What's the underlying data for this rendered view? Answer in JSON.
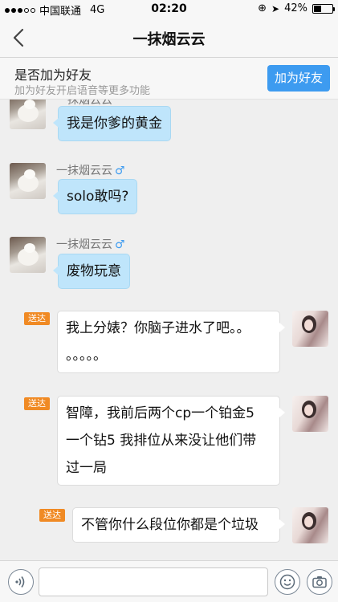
{
  "status_bar": {
    "carrier": "中国联通",
    "network": "4G",
    "time": "02:20",
    "battery_percent": "42%",
    "battery_level": 0.42
  },
  "header": {
    "title": "一抹烟云云"
  },
  "add_friend_banner": {
    "question": "是否加为好友",
    "hint": "加为好友开启语音等更多功能",
    "button_label": "加为好友"
  },
  "messages": [
    {
      "side": "left",
      "sender": "一抹烟云云",
      "text": "我是你爹的黄金"
    },
    {
      "side": "left",
      "sender": "一抹烟云云",
      "gender": "♂",
      "text": "solo敢吗?"
    },
    {
      "side": "left",
      "sender": "一抹烟云云",
      "gender": "♂",
      "text": "废物玩意"
    },
    {
      "side": "right",
      "status": "送达",
      "lines": [
        "我上分婊？你脑子进水了吧。。",
        "。。。。。"
      ]
    },
    {
      "side": "right",
      "status": "送达",
      "lines": [
        "智障，我前后两个cp一个铂金5",
        "一个钻5 我排位从来没让他们带",
        "过一局"
      ]
    },
    {
      "side": "right",
      "status": "送达",
      "lines": [
        "不管你什么段位你都是个垃圾"
      ]
    }
  ],
  "input_bar": {
    "placeholder": ""
  },
  "icons": {
    "back": "chevron-left-icon",
    "voice": "voice-icon",
    "emoji": "emoji-icon",
    "camera": "camera-icon"
  },
  "colors": {
    "accent": "#3d9bf0",
    "incoming_bubble": "#bfe5fb",
    "outgoing_bubble": "#ffffff",
    "status_badge": "#f08a24"
  }
}
